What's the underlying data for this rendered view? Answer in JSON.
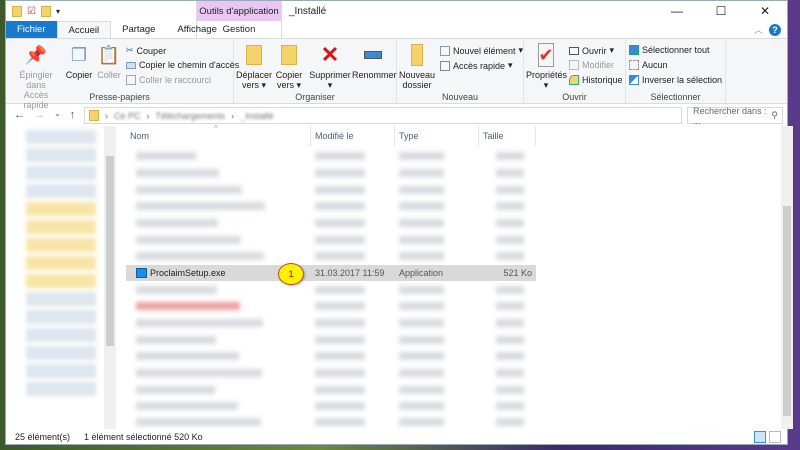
{
  "window": {
    "title": "_Installé",
    "context_tab_group": "Outils d'application",
    "context_tab": "Gestion"
  },
  "tabs": [
    "Fichier",
    "Accueil",
    "Partage",
    "Affichage"
  ],
  "ribbon": {
    "presse_papiers": {
      "label": "Presse-papiers",
      "pin": "Épingler dans Accès rapide",
      "pin_l1": "Épingler dans",
      "pin_l2": "Accès rapide",
      "copy": "Copier",
      "paste": "Coller",
      "cut": "Couper",
      "copy_path": "Copier le chemin d'accès",
      "paste_shortcut": "Coller le raccourci"
    },
    "organiser": {
      "label": "Organiser",
      "move_l1": "Déplacer",
      "move_l2": "vers",
      "copyto_l1": "Copier",
      "copyto_l2": "vers",
      "delete": "Supprimer",
      "rename": "Renommer"
    },
    "nouveau": {
      "label": "Nouveau",
      "new_folder_l1": "Nouveau",
      "new_folder_l2": "dossier",
      "new_item": "Nouvel élément",
      "quick_access": "Accès rapide"
    },
    "ouvrir": {
      "label": "Ouvrir",
      "properties": "Propriétés",
      "open": "Ouvrir",
      "edit": "Modifier",
      "history": "Historique"
    },
    "selectionner": {
      "label": "Sélectionner",
      "select_all": "Sélectionner tout",
      "none": "Aucun",
      "invert": "Inverser la sélection"
    }
  },
  "address": {
    "crumbs": [
      "Ce PC",
      "Téléchargements",
      "_Installé"
    ],
    "search_placeholder": "Rechercher dans : ..."
  },
  "columns": [
    "Nom",
    "Modifié le",
    "Type",
    "Taille"
  ],
  "selected_file": {
    "name": "ProclaimSetup.exe",
    "modified": "31.03.2017 11:59",
    "type": "Application",
    "size": "521 Ko"
  },
  "callout": "1",
  "status": {
    "count": "25 élément(s)",
    "selection": "1 élément sélectionné  520 Ko"
  },
  "colors": {
    "accent": "#1979ca",
    "context_tab": "#e8c8f2",
    "callout": "#fff200"
  }
}
